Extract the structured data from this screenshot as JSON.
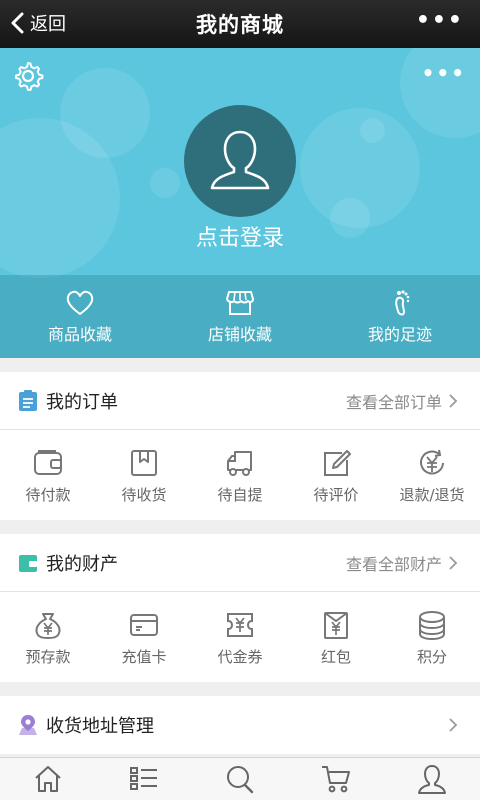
{
  "topbar": {
    "back_label": "返回",
    "title": "我的商城",
    "more": "•••"
  },
  "header": {
    "login_label": "点击登录",
    "more": "•••",
    "favorites": [
      {
        "label": "商品收藏",
        "icon": "heart-icon"
      },
      {
        "label": "店铺收藏",
        "icon": "shop-icon"
      },
      {
        "label": "我的足迹",
        "icon": "footprint-icon"
      }
    ]
  },
  "orders": {
    "title": "我的订单",
    "link": "查看全部订单",
    "items": [
      {
        "label": "待付款",
        "icon": "wallet-icon"
      },
      {
        "label": "待收货",
        "icon": "package-icon"
      },
      {
        "label": "待自提",
        "icon": "truck-icon"
      },
      {
        "label": "待评价",
        "icon": "edit-icon"
      },
      {
        "label": "退款/退货",
        "icon": "refund-icon"
      }
    ]
  },
  "assets": {
    "title": "我的财产",
    "link": "查看全部财产",
    "items": [
      {
        "label": "预存款",
        "icon": "money-bag-icon"
      },
      {
        "label": "充值卡",
        "icon": "card-icon"
      },
      {
        "label": "代金券",
        "icon": "voucher-icon"
      },
      {
        "label": "红包",
        "icon": "red-envelope-icon"
      },
      {
        "label": "积分",
        "icon": "coins-icon"
      }
    ]
  },
  "address": {
    "title": "收货地址管理"
  },
  "tabbar": {
    "tabs": [
      {
        "icon": "home-icon"
      },
      {
        "icon": "list-icon"
      },
      {
        "icon": "search-icon"
      },
      {
        "icon": "cart-icon"
      },
      {
        "icon": "user-icon"
      }
    ]
  },
  "colors": {
    "header_bg": "#5bc6de",
    "accent_icon": "#4aa0d8",
    "asset_icon": "#3cbfa8",
    "address_icon": "#9b7fd6"
  }
}
